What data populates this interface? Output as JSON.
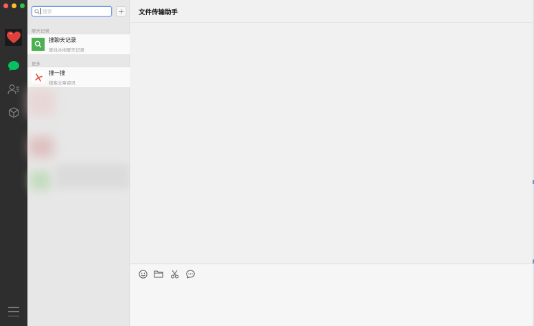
{
  "window": {
    "title": "文件传输助手"
  },
  "search": {
    "placeholder": "搜索",
    "value": ""
  },
  "sections": {
    "chat_history_label": "聊天记录",
    "more_label": "更多"
  },
  "results": [
    {
      "title": "搜聊天记录",
      "subtitle": "查找本地聊天记录",
      "icon": "search-icon"
    },
    {
      "title": "搜一搜",
      "subtitle": "搜索文章资讯",
      "icon": "souyisou-icon"
    }
  ],
  "toolbar": [
    "emoji-icon",
    "folder-icon",
    "scissors-icon",
    "chat-bubble-icon"
  ],
  "colors": {
    "accent": "#07c160",
    "search_focus": "#6f9ae8",
    "result_green": "#4caf50"
  }
}
